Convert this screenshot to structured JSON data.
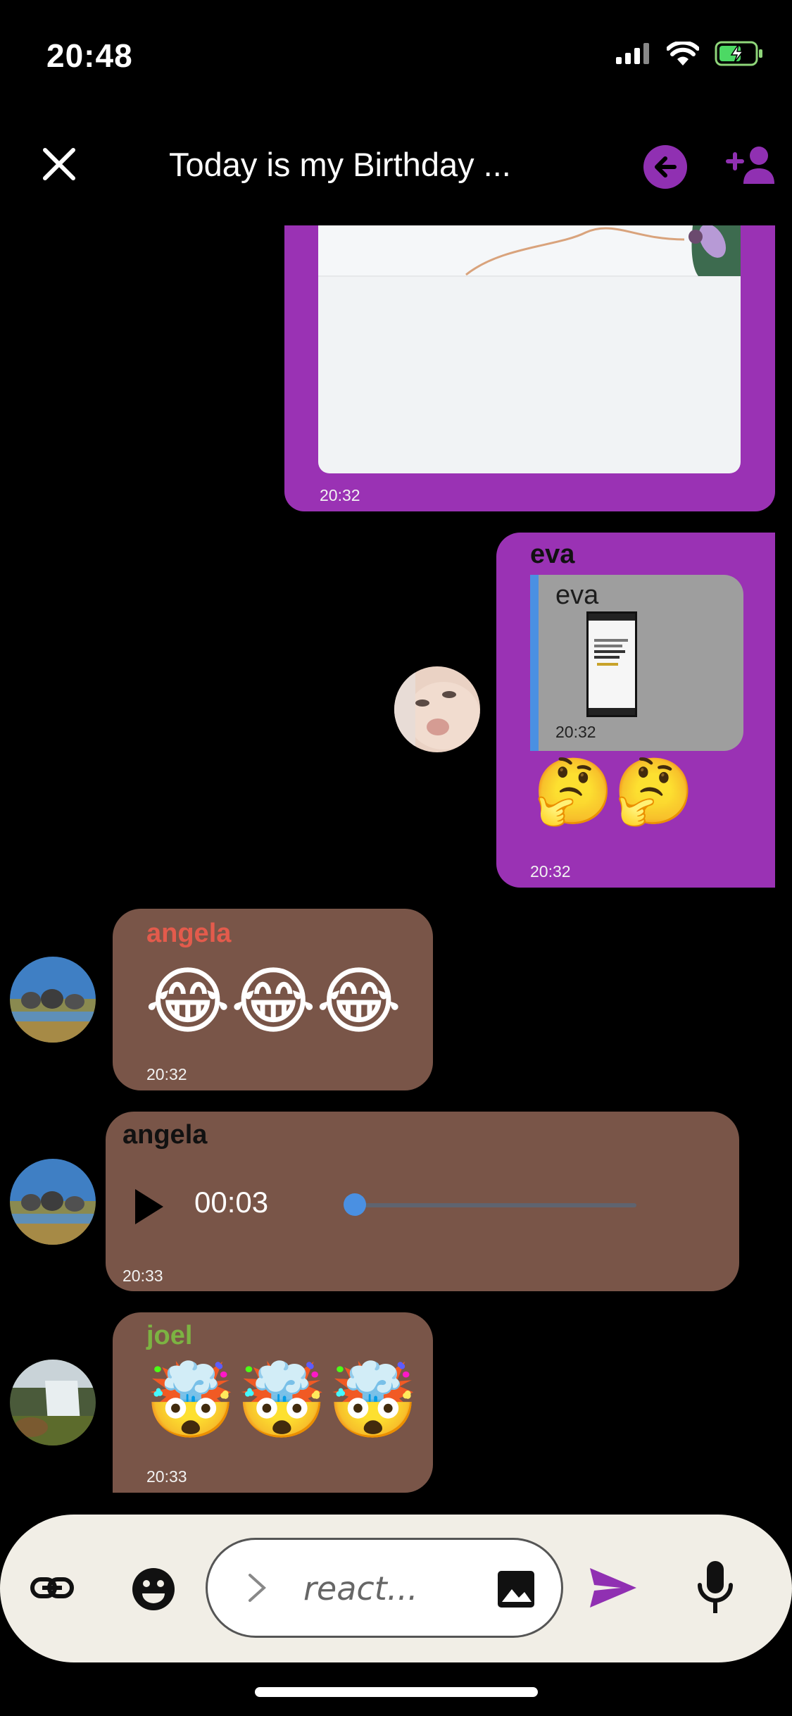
{
  "status_bar": {
    "time": "20:48"
  },
  "header": {
    "title": "Today is my Birthday ..."
  },
  "messages": [
    {
      "kind": "image",
      "time": "20:32"
    },
    {
      "kind": "reply",
      "sender": "eva",
      "reply_to_sender": "eva",
      "reply_time": "20:32",
      "emoji": "🤔🤔",
      "time": "20:32"
    },
    {
      "kind": "emoji",
      "sender": "angela",
      "emoji": "😂😂😂",
      "time": "20:32"
    },
    {
      "kind": "audio",
      "sender": "angela",
      "duration": "00:03",
      "progress": 0.0,
      "time": "20:33"
    },
    {
      "kind": "emoji",
      "sender": "joel",
      "emoji": "🤯🤯🤯",
      "time": "20:33"
    }
  ],
  "composer": {
    "placeholder": "react..."
  },
  "colors": {
    "accent": "#9030b2",
    "own_bubble": "#9a32b4",
    "other_bubble": "#795548",
    "angela": "#e35b4c",
    "joel": "#7cb342",
    "audio_knob": "#4a90e2"
  },
  "icons": [
    "close-icon",
    "back-arrow-icon",
    "add-user-icon",
    "play-icon",
    "link-icon",
    "emoji-icon",
    "chevron-right-icon",
    "image-icon",
    "send-icon",
    "mic-icon"
  ]
}
